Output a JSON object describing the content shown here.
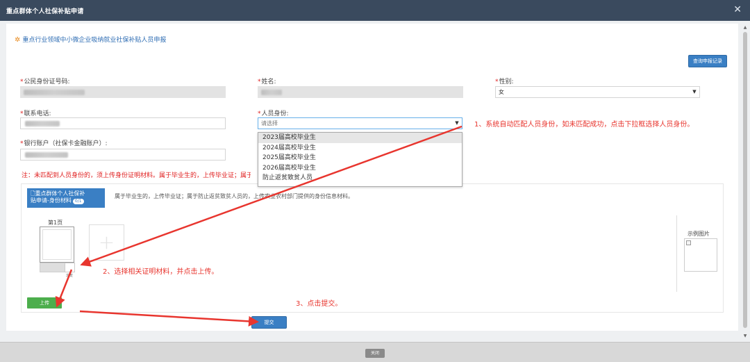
{
  "window": {
    "title": "重点群体个人社保补贴申请",
    "close_glyph": "✕"
  },
  "section": {
    "title": "重点行业领域中小微企业吸纳就业社保补贴人员申报"
  },
  "buttons": {
    "query": "查询申报记录",
    "submit": "提交",
    "close": "关闭",
    "upload": "上传",
    "choose_file": "浏览"
  },
  "form": {
    "id_label": "公民身份证号码:",
    "name_label": "姓名:",
    "gender_label": "性别:",
    "gender_value": "女",
    "phone_label": "联系电话:",
    "identity_label": "人员身份:",
    "identity_placeholder": "请选择",
    "bank_label": "银行账户（社保卡金融账户）:",
    "required_mark": "*"
  },
  "identity_options": [
    "2023届高校毕业生",
    "2024届高校毕业生",
    "2025届高校毕业生",
    "2026届高校毕业生",
    "防止返贫致贫人员"
  ],
  "note": "注：未匹配到人员身份的，须上传身份证明材料。属于毕业生的，上传毕业证；属于防",
  "upload": {
    "tag_line1": "重点群体个人社保补",
    "tag_line2": "贴申请-身份材料",
    "count": "0/1",
    "description": "属于毕业生的，上传毕业证；属于防止返贫致贫人员的，上传农业农村部门提供的身份信息材料。",
    "page_label": "第1页",
    "example_label": "示例图片"
  },
  "annotations": {
    "step1": "1、系统自动匹配人员身份，如未匹配成功，点击下拉框选择人员身份。",
    "step2": "2、选择相关证明材料，并点击上传。",
    "step3": "3、点击提交。"
  },
  "colors": {
    "title_bar": "#3a4a5e",
    "primary": "#3a7fc4",
    "success": "#4cae4c",
    "annotation": "#e8352e",
    "required": "#e02020"
  }
}
